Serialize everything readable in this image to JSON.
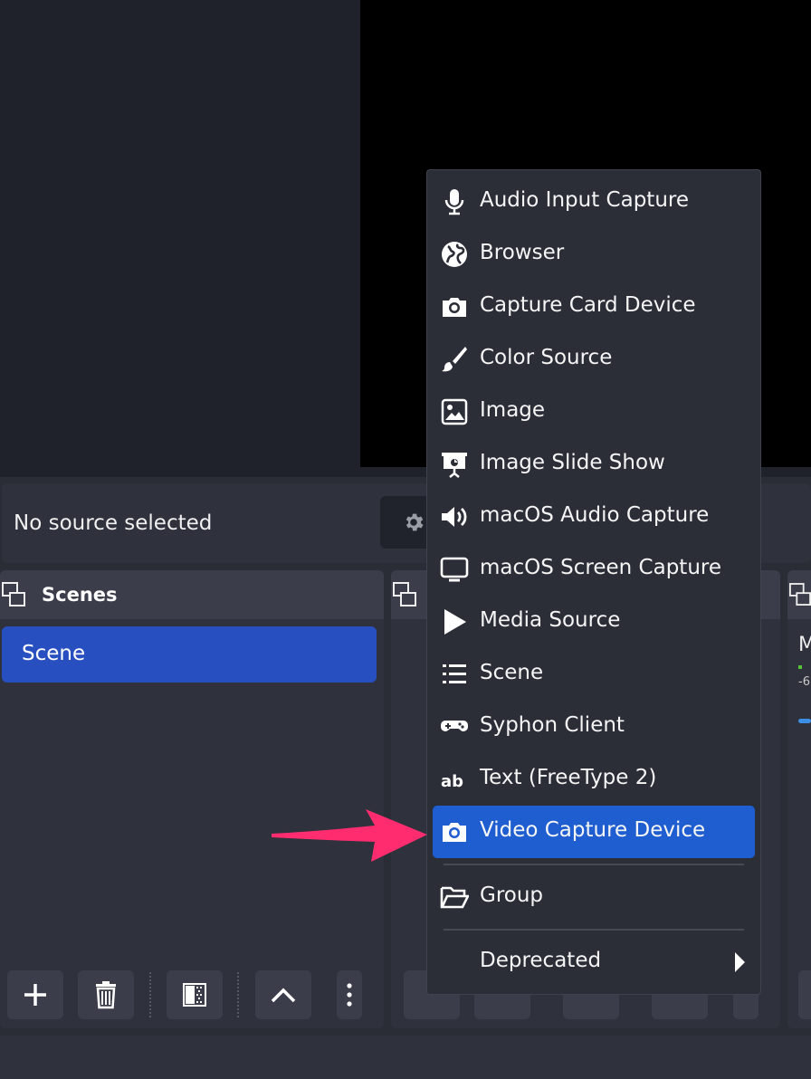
{
  "context_bar": {
    "status_text": "No source selected"
  },
  "scenes_dock": {
    "title": "Scenes",
    "items": [
      {
        "label": "Scene",
        "selected": true
      }
    ],
    "toolbar": [
      {
        "icon": "plus-icon"
      },
      {
        "icon": "trash-icon"
      },
      {
        "icon": "filter-icon"
      },
      {
        "icon": "chevron-up-icon"
      },
      {
        "icon": "more-vertical-icon"
      }
    ]
  },
  "mixer_peek": {
    "letter": "M",
    "db_label": "-6"
  },
  "source_menu": {
    "items": [
      {
        "label": "Audio Input Capture",
        "icon": "microphone-icon"
      },
      {
        "label": "Browser",
        "icon": "globe-icon"
      },
      {
        "label": "Capture Card Device",
        "icon": "camera-icon"
      },
      {
        "label": "Color Source",
        "icon": "paintbrush-icon"
      },
      {
        "label": "Image",
        "icon": "image-icon"
      },
      {
        "label": "Image Slide Show",
        "icon": "slideshow-icon"
      },
      {
        "label": "macOS Audio Capture",
        "icon": "speaker-icon"
      },
      {
        "label": "macOS Screen Capture",
        "icon": "monitor-icon"
      },
      {
        "label": "Media Source",
        "icon": "play-icon"
      },
      {
        "label": "Scene",
        "icon": "list-icon"
      },
      {
        "label": "Syphon Client",
        "icon": "gamepad-icon"
      },
      {
        "label": "Text (FreeType 2)",
        "icon": "text-icon"
      },
      {
        "label": "Video Capture Device",
        "icon": "camera-icon",
        "selected": true
      },
      {
        "label": "Group",
        "icon": "folder-icon"
      },
      {
        "label": "Deprecated",
        "icon": "chevron-right-icon",
        "has_submenu": true
      }
    ]
  },
  "colors": {
    "accent": "#1f5ed0",
    "scene_selected": "#284fc0",
    "pointer_arrow": "#ff2d6f"
  }
}
